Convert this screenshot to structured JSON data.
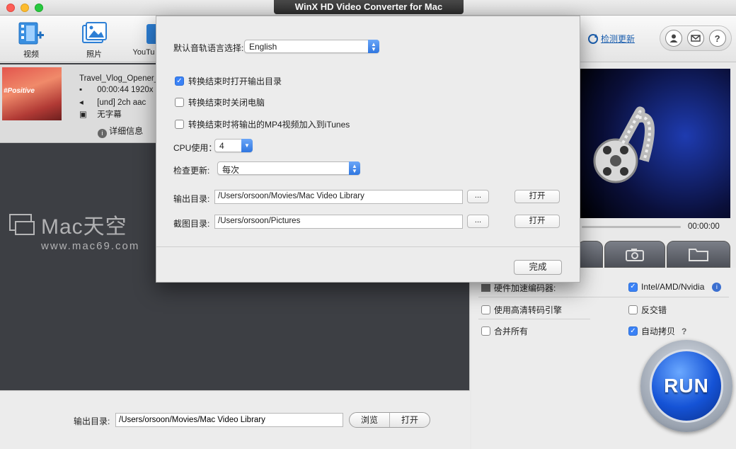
{
  "window": {
    "title": "WinX HD Video Converter for Mac"
  },
  "toolbar": {
    "video_label": "视频",
    "photo_label": "照片",
    "youtube_label": "YouTu",
    "update_link": "检测更新",
    "help_symbol": "?"
  },
  "file_item": {
    "thumbnail_text": "#Positive",
    "name": "Travel_Vlog_Opener_",
    "duration": "00:00:44 1920x",
    "audio": "[und] 2ch aac",
    "subtitle": "无字幕",
    "detail_button": "详细信息"
  },
  "watermark": {
    "big": "Mac天空",
    "small": "www.mac69.com"
  },
  "preview": {
    "time": "00:00:00"
  },
  "options": {
    "hw_encoder": "硬件加速编码器:",
    "intel": "Intel/AMD/Nvidia",
    "hq_engine": "使用高清转码引擎",
    "deinterlace": "反交错",
    "merge_all": "合并所有",
    "auto_copy": "自动拷贝",
    "auto_copy_help": "?"
  },
  "run_button": "RUN",
  "bottom": {
    "output_label": "输出目录:",
    "output_path": "/Users/orsoon/Movies/Mac Video Library",
    "browse": "浏览",
    "open": "打开"
  },
  "dialog": {
    "audio_lang_label": "默认音轨语言选择:",
    "audio_lang_value": "English",
    "open_output_dir": "转换结束时打开输出目录",
    "open_output_dir_checked": true,
    "shutdown": "转换结束时关闭电脑",
    "shutdown_checked": false,
    "add_itunes": "转换结束时将输出的MP4视频加入到iTunes",
    "add_itunes_checked": false,
    "cpu_label": "CPU使用：",
    "cpu_value": "4",
    "check_update_label": "检查更新:",
    "check_update_value": "每次",
    "output_dir_label": "输出目录:",
    "output_dir_value": "/Users/orsoon/Movies/Mac Video Library",
    "snapshot_dir_label": "截图目录:",
    "snapshot_dir_value": "/Users/orsoon/Pictures",
    "ellipsis": "...",
    "open_button": "打开",
    "done_button": "完成"
  },
  "colors": {
    "accent": "#3b82f6",
    "panel_dark": "#3d3f44",
    "link": "#1c5fae"
  }
}
